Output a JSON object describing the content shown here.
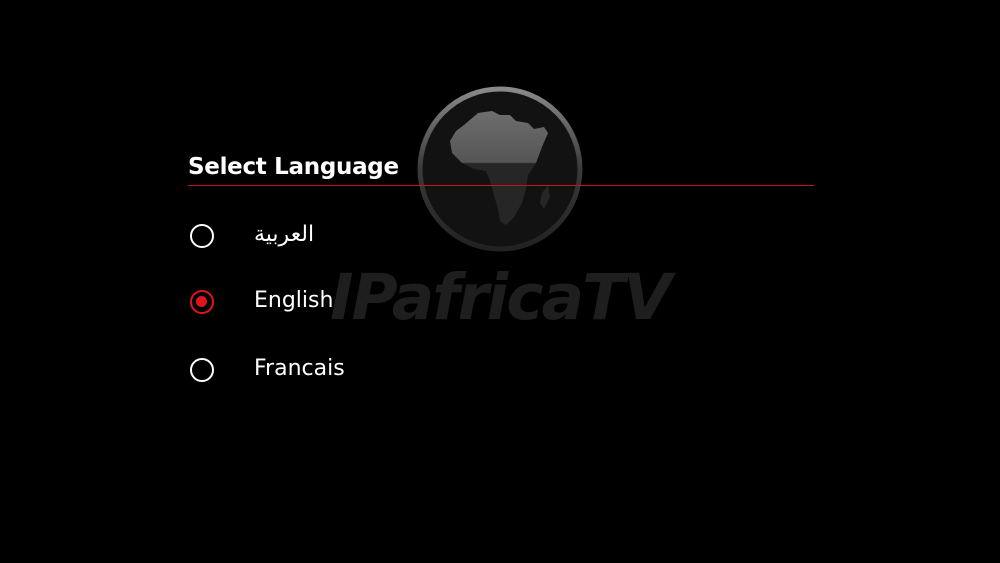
{
  "brand": {
    "logo_text": "IPafricaTV",
    "watermark_color": "#1e1e1e"
  },
  "dialog": {
    "title": "Select Language",
    "accent_color": "#e0141b",
    "options": [
      {
        "label": "العربية",
        "selected": false
      },
      {
        "label": "English",
        "selected": true
      },
      {
        "label": "Francais",
        "selected": false
      }
    ]
  }
}
